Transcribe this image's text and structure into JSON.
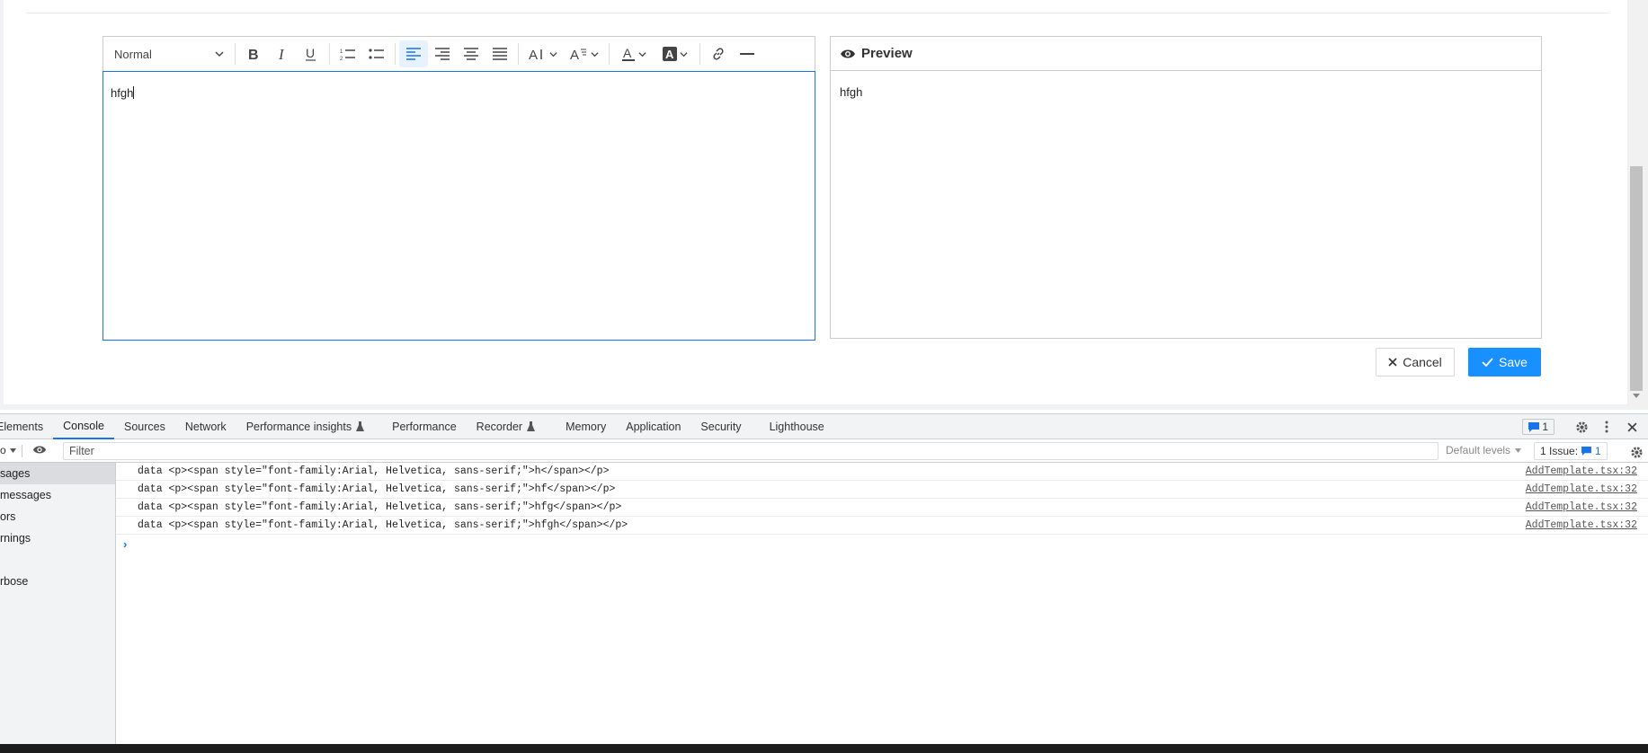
{
  "editor": {
    "toolbar": {
      "heading_select": "Normal",
      "buttons": [
        "bold",
        "italic",
        "underline",
        "ordered-list",
        "bullet-list",
        "align-left",
        "align-right",
        "align-center",
        "align-justify",
        "font-size",
        "font-family",
        "text-color",
        "background-color",
        "link",
        "horizontal-rule"
      ],
      "active": "align-left"
    },
    "content": "hfgh"
  },
  "preview": {
    "title": "Preview",
    "content": "hfgh"
  },
  "actions": {
    "cancel_label": "Cancel",
    "save_label": "Save"
  },
  "devtools": {
    "tabs": [
      {
        "label": "Elements"
      },
      {
        "label": "Console"
      },
      {
        "label": "Sources"
      },
      {
        "label": "Network"
      },
      {
        "label": "Performance insights"
      },
      {
        "label": "Performance"
      },
      {
        "label": "Recorder"
      },
      {
        "label": "Memory"
      },
      {
        "label": "Application"
      },
      {
        "label": "Security"
      },
      {
        "label": "Lighthouse"
      }
    ],
    "active_tab": "Console",
    "issues_badge": "1",
    "filter_placeholder": "Filter",
    "default_levels": "Default levels",
    "issue_button": "1 Issue:",
    "issue_count": "1",
    "sidebar": [
      "sages",
      "messages",
      "ors",
      "rnings",
      "",
      "rbose"
    ],
    "context_label": "o",
    "log": [
      {
        "text": "data <p><span style=\"font-family:Arial, Helvetica, sans-serif;\">h</span></p>",
        "source": "AddTemplate.tsx:32"
      },
      {
        "text": "data <p><span style=\"font-family:Arial, Helvetica, sans-serif;\">hf</span></p>",
        "source": "AddTemplate.tsx:32"
      },
      {
        "text": "data <p><span style=\"font-family:Arial, Helvetica, sans-serif;\">hfg</span></p>",
        "source": "AddTemplate.tsx:32"
      },
      {
        "text": "data <p><span style=\"font-family:Arial, Helvetica, sans-serif;\">hfgh</span></p>",
        "source": "AddTemplate.tsx:32"
      }
    ],
    "prompt": "›"
  },
  "colors": {
    "accent": "#1890ff",
    "devtools_tab_active": "#1a73e8"
  }
}
